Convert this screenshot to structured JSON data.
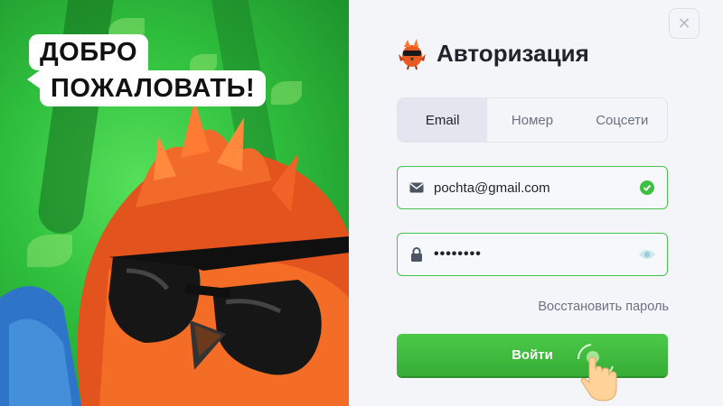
{
  "promo": {
    "welcome_line1": "ДОБРО",
    "welcome_line2": "ПОЖАЛОВАТЬ!"
  },
  "auth": {
    "close_icon": "close-icon",
    "title": "Авторизация",
    "tabs": [
      {
        "label": "Email",
        "active": true
      },
      {
        "label": "Номер",
        "active": false
      },
      {
        "label": "Соцсети",
        "active": false
      }
    ],
    "email_value": "pochta@gmail.com",
    "password_value": "••••••••",
    "forgot_label": "Восстановить пароль",
    "submit_label": "Войти"
  },
  "colors": {
    "accent_green": "#3fbf42",
    "panel_bg": "#f4f5f9",
    "promo_green": "#2fbf3d"
  }
}
